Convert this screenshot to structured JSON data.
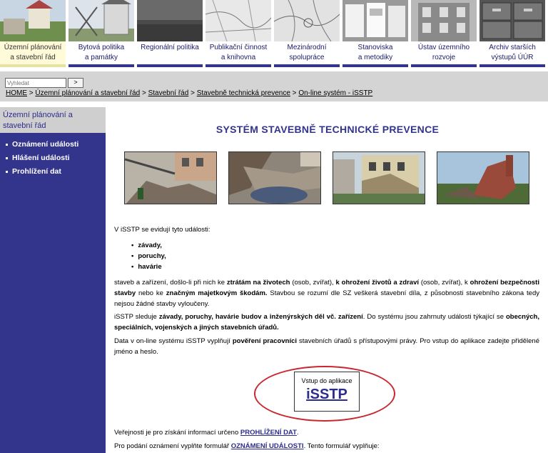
{
  "nav": [
    {
      "line1": "Územní plánování",
      "line2": "a stavební řád",
      "active": true
    },
    {
      "line1": "Bytová politika",
      "line2": "a památky",
      "active": false
    },
    {
      "line1": "Regionální politika",
      "line2": "",
      "active": false
    },
    {
      "line1": "Publikační činnost",
      "line2": "a knihovna",
      "active": false
    },
    {
      "line1": "Mezinárodní",
      "line2": "spolupráce",
      "active": false
    },
    {
      "line1": "Stanoviska",
      "line2": "a metodiky",
      "active": false
    },
    {
      "line1": "Ústav územního",
      "line2": "rozvoje",
      "active": false
    },
    {
      "line1": "Archiv starších",
      "line2": "výstupů ÚÚR",
      "active": false
    }
  ],
  "search": {
    "placeholder": "Vyhledat",
    "button": ">"
  },
  "breadcrumb": {
    "home": "HOME",
    "sep": " > ",
    "c1": "Územní plánování a stavební řád",
    "c2": "Stavební řád",
    "c3": "Stavebně technická prevence",
    "c4": "On-line systém - iSSTP"
  },
  "sidebar": {
    "heading": "Územní plánování a stavební řád",
    "items": [
      "Oznámení události",
      "Hlášení události",
      "Prohlížení dat"
    ]
  },
  "main": {
    "title": "SYSTÉM STAVEBNĚ TECHNICKÉ PREVENCE",
    "intro": "V iSSTP se evidují tyto události:",
    "events": [
      "závady,",
      "poruchy,",
      "havárie"
    ],
    "p1": {
      "a": "staveb a zařízení, došlo-li při nich ke ",
      "b": "ztrátám na životech",
      "c": " (osob, zvířat), ",
      "d": "k ohrožení životů a zdraví",
      "e": " (osob, zvířat), k ",
      "f": "ohrožení bezpečnosti stavby",
      "g": " nebo ke ",
      "h": "značným majetkovým škodám.",
      "i": " Stavbou se rozumí dle SZ veškerá stavební díla, z působnosti stavebního zákona tedy nejsou žádné stavby vyloučeny."
    },
    "p2": {
      "a": "iSSTP sleduje ",
      "b": "závady, poruchy, havárie budov a inženýrských děl vč. zařízení",
      "c": ". Do systému jsou zahrnuty události týkající se ",
      "d": "obecných, speciálních, vojenských a jiných stavebních úřadů."
    },
    "p3": {
      "a": "Data v on-line systému iSSTP vyplňují ",
      "b": "pověření pracovníci",
      "c": " stavebních úřadů s přístupovými právy. Pro vstup do aplikace zadejte přidělené jméno a heslo."
    },
    "login": {
      "caption": "Vstup do aplikace",
      "link": "iSSTP"
    },
    "p4": {
      "a": "Veřejnosti je pro získání informací určeno ",
      "b": "PROHLÍŽENÍ DAT",
      "c": "."
    },
    "p5": {
      "a": "Pro podání oznámení vyplňte formulář ",
      "b": "OZNÁMENÍ UDÁLOSTI",
      "c": ". Tento formulář vyplňuje:"
    }
  },
  "colors": {
    "brand": "#33348c",
    "highlight": "#c8282f"
  }
}
